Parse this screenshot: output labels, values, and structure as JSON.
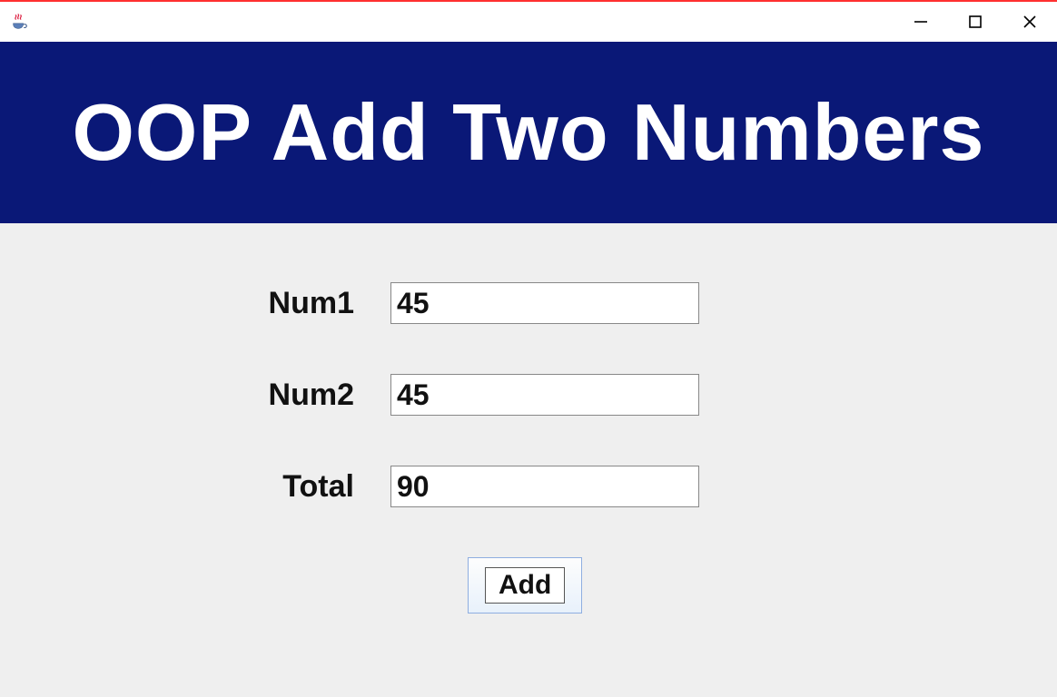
{
  "window": {
    "title": ""
  },
  "header": {
    "title": "OOP Add Two Numbers"
  },
  "form": {
    "num1": {
      "label": "Num1",
      "value": "45"
    },
    "num2": {
      "label": "Num2",
      "value": "45"
    },
    "total": {
      "label": "Total",
      "value": "90"
    },
    "add_button_label": "Add"
  },
  "colors": {
    "banner_bg": "#0a1877",
    "content_bg": "#efefef"
  }
}
